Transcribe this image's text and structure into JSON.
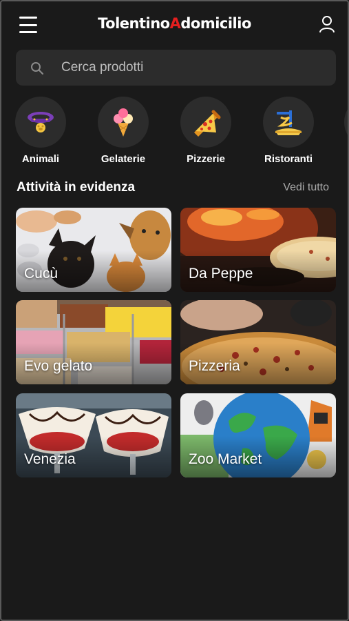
{
  "header": {
    "logo_part1": "Tolentino",
    "logo_accent": "A",
    "logo_part2": "domicilio",
    "menu_icon": "hamburger-menu-icon",
    "user_icon": "user-icon"
  },
  "search": {
    "placeholder": "Cerca prodotti",
    "value": "",
    "icon": "search-icon"
  },
  "categories": [
    {
      "label": "Animali",
      "icon": "pet-collar-icon"
    },
    {
      "label": "Gelaterie",
      "icon": "ice-cream-icon"
    },
    {
      "label": "Pizzerie",
      "icon": "pizza-slice-icon"
    },
    {
      "label": "Ristoranti",
      "icon": "pasta-icon"
    }
  ],
  "featured": {
    "title": "Attività in evidenza",
    "see_all": "Vedi tutto",
    "items": [
      {
        "name": "Cucù"
      },
      {
        "name": "Da Peppe"
      },
      {
        "name": "Evo gelato"
      },
      {
        "name": "Pizzeria"
      },
      {
        "name": "Venezia"
      },
      {
        "name": "Zoo Market"
      }
    ]
  },
  "colors": {
    "background": "#1a1a1a",
    "surface": "#2c2c2c",
    "logo_accent": "#e41f1f",
    "muted_text": "#a9a9a9"
  }
}
